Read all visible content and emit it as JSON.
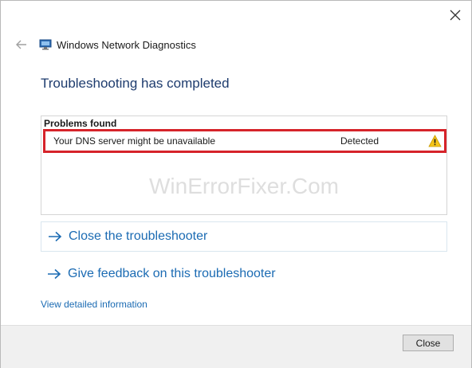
{
  "window": {
    "title": "Windows Network Diagnostics",
    "close_symbol": "close-icon",
    "back_symbol": "back-arrow-icon",
    "app_icon": "network-diagnostics-icon"
  },
  "main": {
    "heading": "Troubleshooting has completed",
    "problems": {
      "header": "Problems found",
      "rows": [
        {
          "name": "Your DNS server might be unavailable",
          "status": "Detected",
          "icon": "warning-icon",
          "highlight_color": "#d6232a"
        }
      ]
    },
    "watermark": "WinErrorFixer.Com",
    "actions": [
      {
        "label": "Close the troubleshooter",
        "icon": "arrow-right-icon"
      },
      {
        "label": "Give feedback on this troubleshooter",
        "icon": "arrow-right-icon"
      }
    ],
    "detail_link": "View detailed information"
  },
  "footer": {
    "close_label": "Close"
  },
  "colors": {
    "heading": "#1e3c6e",
    "link": "#1b6bb3",
    "warning": "#f5c518"
  }
}
